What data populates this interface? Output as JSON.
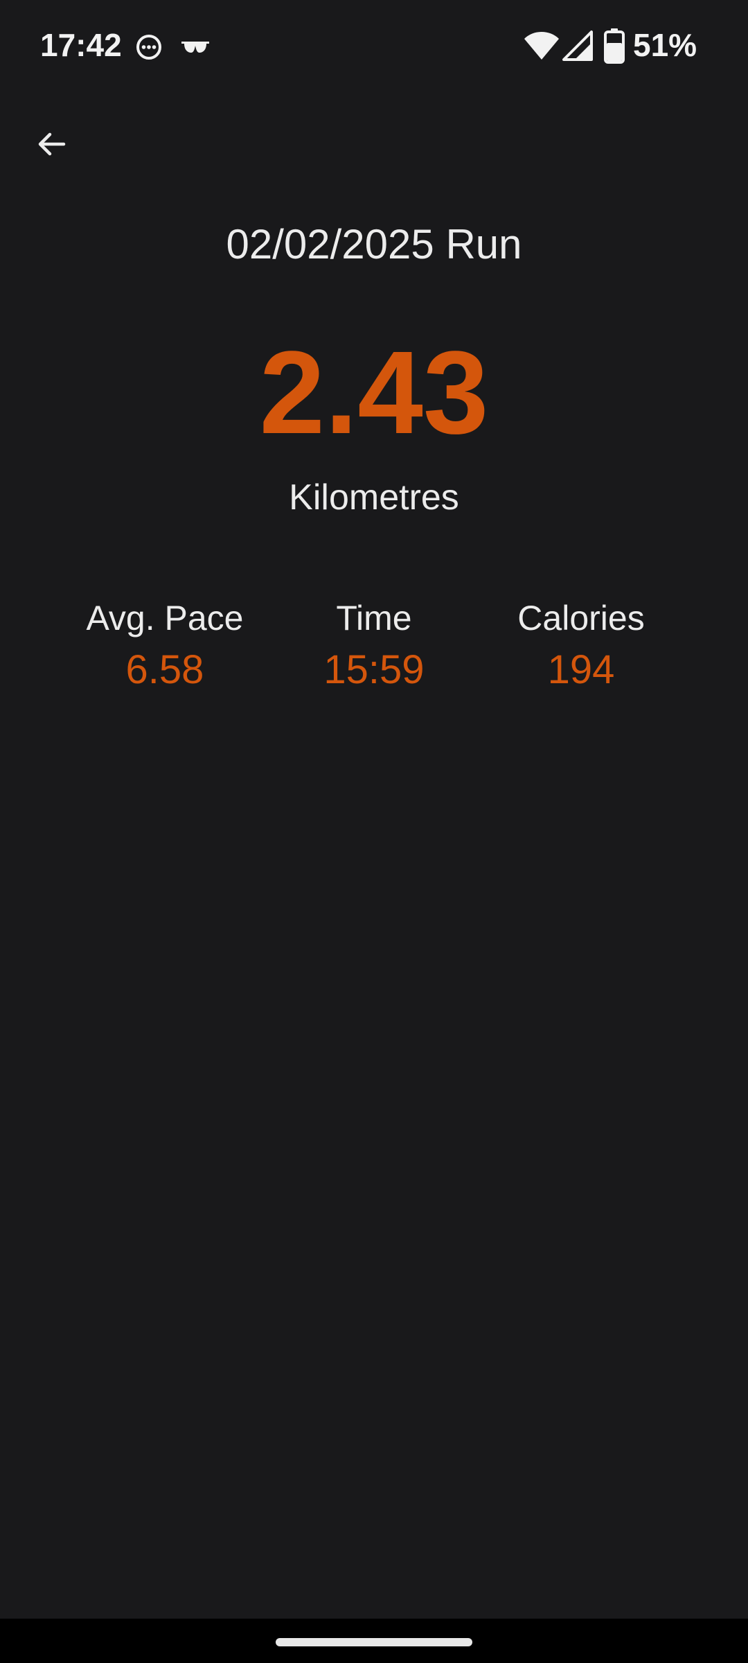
{
  "status_bar": {
    "time": "17:42",
    "battery_percent": "51%",
    "icons": [
      "chat-bubble-icon",
      "glasses-icon",
      "wifi-icon",
      "signal-icon",
      "battery-icon"
    ]
  },
  "app_bar": {
    "back_icon": "arrow-left-icon"
  },
  "run": {
    "title": "02/02/2025 Run",
    "distance": "2.43",
    "distance_unit": "Kilometres",
    "stats": {
      "pace_label": "Avg. Pace",
      "pace_value": "6.58",
      "time_label": "Time",
      "time_value": "15:59",
      "calories_label": "Calories",
      "calories_value": "194"
    }
  },
  "colors": {
    "background": "#19191b",
    "accent": "#d4560c",
    "text": "#ececec"
  }
}
